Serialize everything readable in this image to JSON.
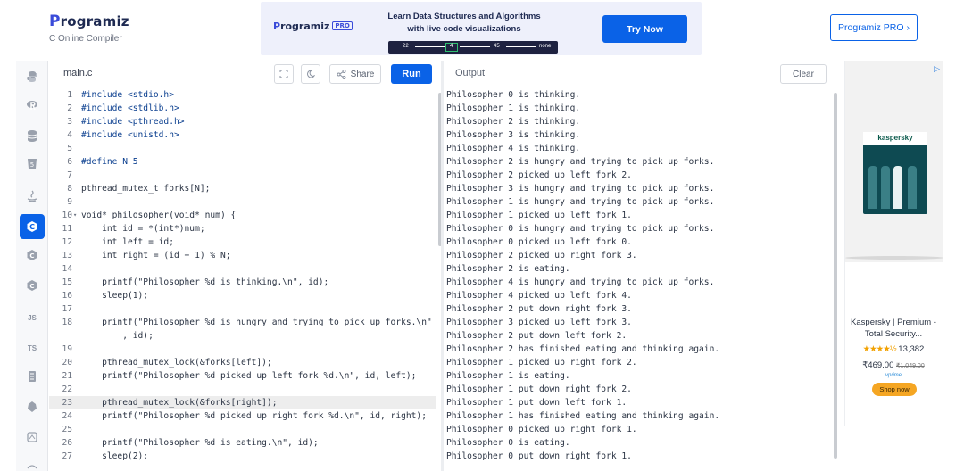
{
  "header": {
    "logo_text": "rogramiz",
    "logo_subtitle": "C Online Compiler",
    "banner": {
      "logo_text": "rogramiz",
      "pro_tag": "PRO",
      "text_line1": "Learn Data Structures and Algorithms",
      "text_line2": "with live code visualizations",
      "viz_labels": [
        "22",
        "4",
        "45",
        "none"
      ],
      "cta_label": "Try Now"
    },
    "pro_button_label": "Programiz PRO ›"
  },
  "sidebar": {
    "items": [
      {
        "icon": "python-icon"
      },
      {
        "icon": "r-icon"
      },
      {
        "icon": "sql-icon"
      },
      {
        "icon": "html-icon"
      },
      {
        "icon": "java-icon"
      },
      {
        "icon": "c-icon",
        "active": true
      },
      {
        "icon": "cpp-icon"
      },
      {
        "icon": "csharp-icon"
      },
      {
        "icon": "javascript-icon",
        "label": "JS"
      },
      {
        "icon": "typescript-icon",
        "label": "TS"
      },
      {
        "icon": "php-icon"
      },
      {
        "icon": "go-icon"
      },
      {
        "icon": "swift-icon"
      }
    ]
  },
  "editor": {
    "filename": "main.c",
    "share_label": "Share",
    "run_label": "Run",
    "highlighted_line": "23",
    "lines": [
      {
        "n": "1",
        "code": "#include <stdio.h>"
      },
      {
        "n": "2",
        "code": "#include <stdlib.h>"
      },
      {
        "n": "3",
        "code": "#include <pthread.h>"
      },
      {
        "n": "4",
        "code": "#include <unistd.h>"
      },
      {
        "n": "5",
        "code": ""
      },
      {
        "n": "6",
        "code": "#define N 5"
      },
      {
        "n": "7",
        "code": ""
      },
      {
        "n": "8",
        "code": "pthread_mutex_t forks[N];"
      },
      {
        "n": "9",
        "code": ""
      },
      {
        "n": "10",
        "code": "void* philosopher(void* num) {",
        "fold": "▾"
      },
      {
        "n": "11",
        "code": "    int id = *(int*)num;"
      },
      {
        "n": "12",
        "code": "    int left = id;"
      },
      {
        "n": "13",
        "code": "    int right = (id + 1) % N;"
      },
      {
        "n": "14",
        "code": ""
      },
      {
        "n": "15",
        "code": "    printf(\"Philosopher %d is thinking.\\n\", id);"
      },
      {
        "n": "16",
        "code": "    sleep(1);"
      },
      {
        "n": "17",
        "code": ""
      },
      {
        "n": "18",
        "code": "    printf(\"Philosopher %d is hungry and trying to pick up forks.\\n\""
      },
      {
        "n": "",
        "code": "        , id);"
      },
      {
        "n": "19",
        "code": ""
      },
      {
        "n": "20",
        "code": "    pthread_mutex_lock(&forks[left]);"
      },
      {
        "n": "21",
        "code": "    printf(\"Philosopher %d picked up left fork %d.\\n\", id, left);"
      },
      {
        "n": "22",
        "code": ""
      },
      {
        "n": "23",
        "code": "    pthread_mutex_lock(&forks[right]);"
      },
      {
        "n": "24",
        "code": "    printf(\"Philosopher %d picked up right fork %d.\\n\", id, right);"
      },
      {
        "n": "25",
        "code": ""
      },
      {
        "n": "26",
        "code": "    printf(\"Philosopher %d is eating.\\n\", id);"
      },
      {
        "n": "27",
        "code": "    sleep(2);"
      }
    ]
  },
  "output": {
    "title": "Output",
    "clear_label": "Clear",
    "lines": [
      "Philosopher 0 is thinking.",
      "Philosopher 1 is thinking.",
      "Philosopher 2 is thinking.",
      "Philosopher 3 is thinking.",
      "Philosopher 4 is thinking.",
      "Philosopher 2 is hungry and trying to pick up forks.",
      "Philosopher 2 picked up left fork 2.",
      "Philosopher 3 is hungry and trying to pick up forks.",
      "Philosopher 1 is hungry and trying to pick up forks.",
      "Philosopher 1 picked up left fork 1.",
      "Philosopher 0 is hungry and trying to pick up forks.",
      "Philosopher 0 picked up left fork 0.",
      "Philosopher 2 picked up right fork 3.",
      "Philosopher 2 is eating.",
      "Philosopher 4 is hungry and trying to pick up forks.",
      "Philosopher 4 picked up left fork 4.",
      "Philosopher 2 put down right fork 3.",
      "Philosopher 3 picked up left fork 3.",
      "Philosopher 2 put down left fork 2.",
      "Philosopher 2 has finished eating and thinking again.",
      "Philosopher 1 picked up right fork 2.",
      "Philosopher 1 is eating.",
      "Philosopher 1 put down right fork 2.",
      "Philosopher 1 put down left fork 1.",
      "Philosopher 1 has finished eating and thinking again.",
      "Philosopher 0 picked up right fork 1.",
      "Philosopher 0 is eating.",
      "Philosopher 0 put down right fork 1."
    ]
  },
  "ad": {
    "brand": "kaspersky",
    "title": "Kaspersky | Premium - Total Security...",
    "rating_count": "13,382",
    "price": "₹469.00",
    "old_price": "₹1,049.00",
    "prime": "vprime",
    "shop_label": "Shop now",
    "colors": {
      "accent": "#f5a623",
      "brand": "#0b5a4c"
    }
  },
  "colors": {
    "accent": "#0a62e7",
    "include_keyword": "#0b3f8f",
    "string": "#b33a00"
  }
}
